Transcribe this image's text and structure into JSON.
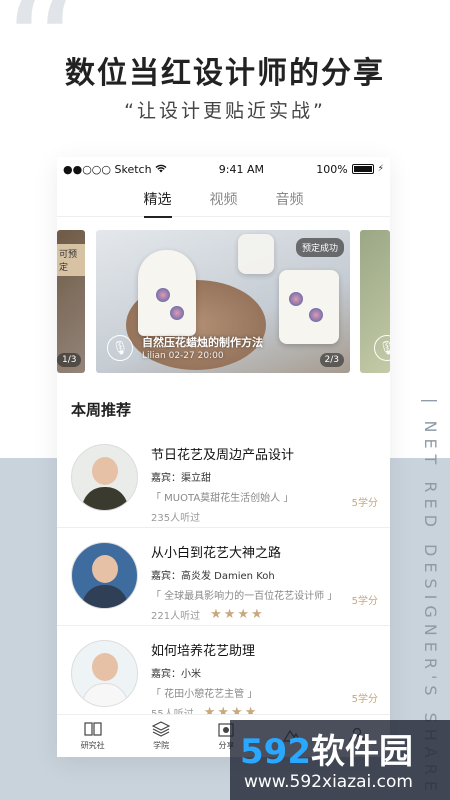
{
  "headline": "数位当红设计师的分享",
  "subline": "“让设计更贴近实战”",
  "vertical_deco": "| NET RED DESIGNER'S SHARE",
  "statusbar": {
    "carrier": "●●○○○ Sketch",
    "time": "9:41 AM",
    "battery": "100%"
  },
  "tabs": [
    "精选",
    "视频",
    "音频"
  ],
  "carousel": {
    "left_badge": "可预定",
    "left_page": "1/3",
    "main": {
      "badge": "预定成功",
      "title": "自然压花蜡烛的制作方法",
      "meta": "Lilian   02-27  20:00",
      "page": "2/3"
    }
  },
  "section_title": "本周推荐",
  "items": [
    {
      "title": "节日花艺及周边产品设计",
      "guest": "嘉宾：渠立甜",
      "intro": "「 MUOTA莫甜花生活创始人 」",
      "listeners": "235人听过",
      "stars": "",
      "credits": "5学分",
      "avatar_color": "#3a3a2e"
    },
    {
      "title": "从小白到花艺大神之路",
      "guest": "嘉宾：高炎发 Damien Koh",
      "intro": "「 全球最具影响力的一百位花艺设计师 」",
      "listeners": "221人听过",
      "stars": "★★★★",
      "credits": "5学分",
      "avatar_color": "#2f3f55"
    },
    {
      "title": "如何培养花艺助理",
      "guest": "嘉宾：小米",
      "intro": "「 花田小憩花艺主管 」",
      "listeners": "55人听过",
      "stars": "★★★★",
      "credits": "5学分",
      "avatar_color": "#e7eef2"
    }
  ],
  "navbar": [
    "研究社",
    "学院",
    "分享",
    "",
    ""
  ],
  "watermark": {
    "main_a": "592",
    "main_b": "软件园",
    "url": "www.592xiazai.com"
  }
}
